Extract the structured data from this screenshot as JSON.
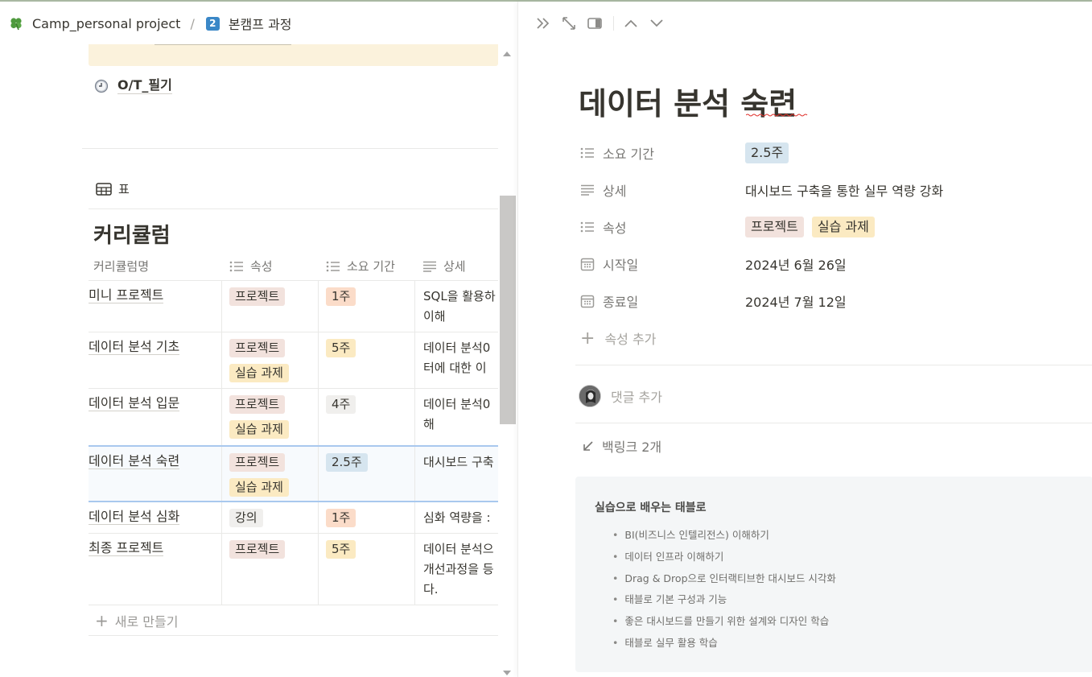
{
  "breadcrumb": {
    "workspace": "Camp_personal project",
    "separator": "/",
    "page_number": "2",
    "page": "본캠프 과정"
  },
  "left": {
    "page_link": "O/T_필기",
    "view_tab": "표",
    "database_title": "커리큘럼",
    "columns": [
      "커리큘럼명",
      "속성",
      "소요 기간",
      "상세"
    ],
    "rows": [
      {
        "name": "미니 프로젝트",
        "attrs": [
          "프로젝트"
        ],
        "attr_colors": [
          "proj"
        ],
        "duration": "1주",
        "duration_color": "orange",
        "desc": [
          "SQL을 활용하",
          "이해"
        ]
      },
      {
        "name": "데이터 분석 기초",
        "attrs": [
          "프로젝트",
          "실습 과제"
        ],
        "attr_colors": [
          "proj",
          "prac"
        ],
        "duration": "5주",
        "duration_color": "yellow",
        "desc": [
          "데이터 분석0",
          "터에 대한 이"
        ]
      },
      {
        "name": "데이터 분석 입문",
        "attrs": [
          "프로젝트",
          "실습 과제"
        ],
        "attr_colors": [
          "proj",
          "prac"
        ],
        "duration": "4주",
        "duration_color": "gray",
        "desc": [
          "데이터 분석0",
          "해"
        ]
      },
      {
        "name": "데이터 분석 숙련",
        "attrs": [
          "프로젝트",
          "실습 과제"
        ],
        "attr_colors": [
          "proj",
          "prac"
        ],
        "duration": "2.5주",
        "duration_color": "blue",
        "desc": [
          "대시보드 구축"
        ],
        "selected": true
      },
      {
        "name": "데이터 분석 심화",
        "attrs": [
          "강의"
        ],
        "attr_colors": [
          "lect"
        ],
        "duration": "1주",
        "duration_color": "orange",
        "desc": [
          "심화 역량을 :"
        ]
      },
      {
        "name": "최종 프로젝트",
        "attrs": [
          "프로젝트"
        ],
        "attr_colors": [
          "proj"
        ],
        "duration": "5주",
        "duration_color": "yellow",
        "desc": [
          "데이터 분석으",
          "개선과정을 등",
          "다."
        ]
      }
    ],
    "new_row": "새로 만들기"
  },
  "right": {
    "title": "데이터 분석 숙련",
    "properties": {
      "duration_label": "소요 기간",
      "duration_value": "2.5주",
      "detail_label": "상세",
      "detail_value": "대시보드 구축을 통한 실무 역량 강화",
      "attr_label": "속성",
      "attr_values": [
        "프로젝트",
        "실습 과제"
      ],
      "start_label": "시작일",
      "start_value": "2024년 6월 26일",
      "end_label": "종료일",
      "end_value": "2024년 7월 12일",
      "add_property": "속성 추가"
    },
    "comment_placeholder": "댓글 추가",
    "backlinks": "백링크 2개",
    "card": {
      "title": "실습으로 배우는 태블로",
      "items": [
        "BI(비즈니스 인텔리전스) 이해하기",
        "데이터 인프라 이해하기",
        "Drag & Drop으로 인터랙티브한 대시보드 시각화",
        "태블로 기본 구성과 기능",
        "좋은 대시보드를 만들기 위한 설계와 디자인 학습",
        "태블로 실무 활용 학습"
      ]
    }
  },
  "colors": {
    "tag_project": "#f2e2dd",
    "tag_practice": "#fbeac2",
    "tag_lecture": "#f0efed",
    "dur_orange": "#fbdcc9",
    "dur_yellow": "#fbeac2",
    "dur_gray": "#f0efed",
    "dur_blue": "#d6e5ef",
    "callout_bg": "#fbf2dc",
    "selection": "#a9c8ee"
  },
  "icons": [
    "clover-icon",
    "clock-icon",
    "table-icon",
    "list-icon",
    "text-icon",
    "calendar-icon",
    "plus-icon",
    "arrow-down-left-icon",
    "double-chevron-right-icon",
    "expand-icon",
    "side-peek-icon",
    "chevron-up-icon",
    "chevron-down-icon"
  ]
}
